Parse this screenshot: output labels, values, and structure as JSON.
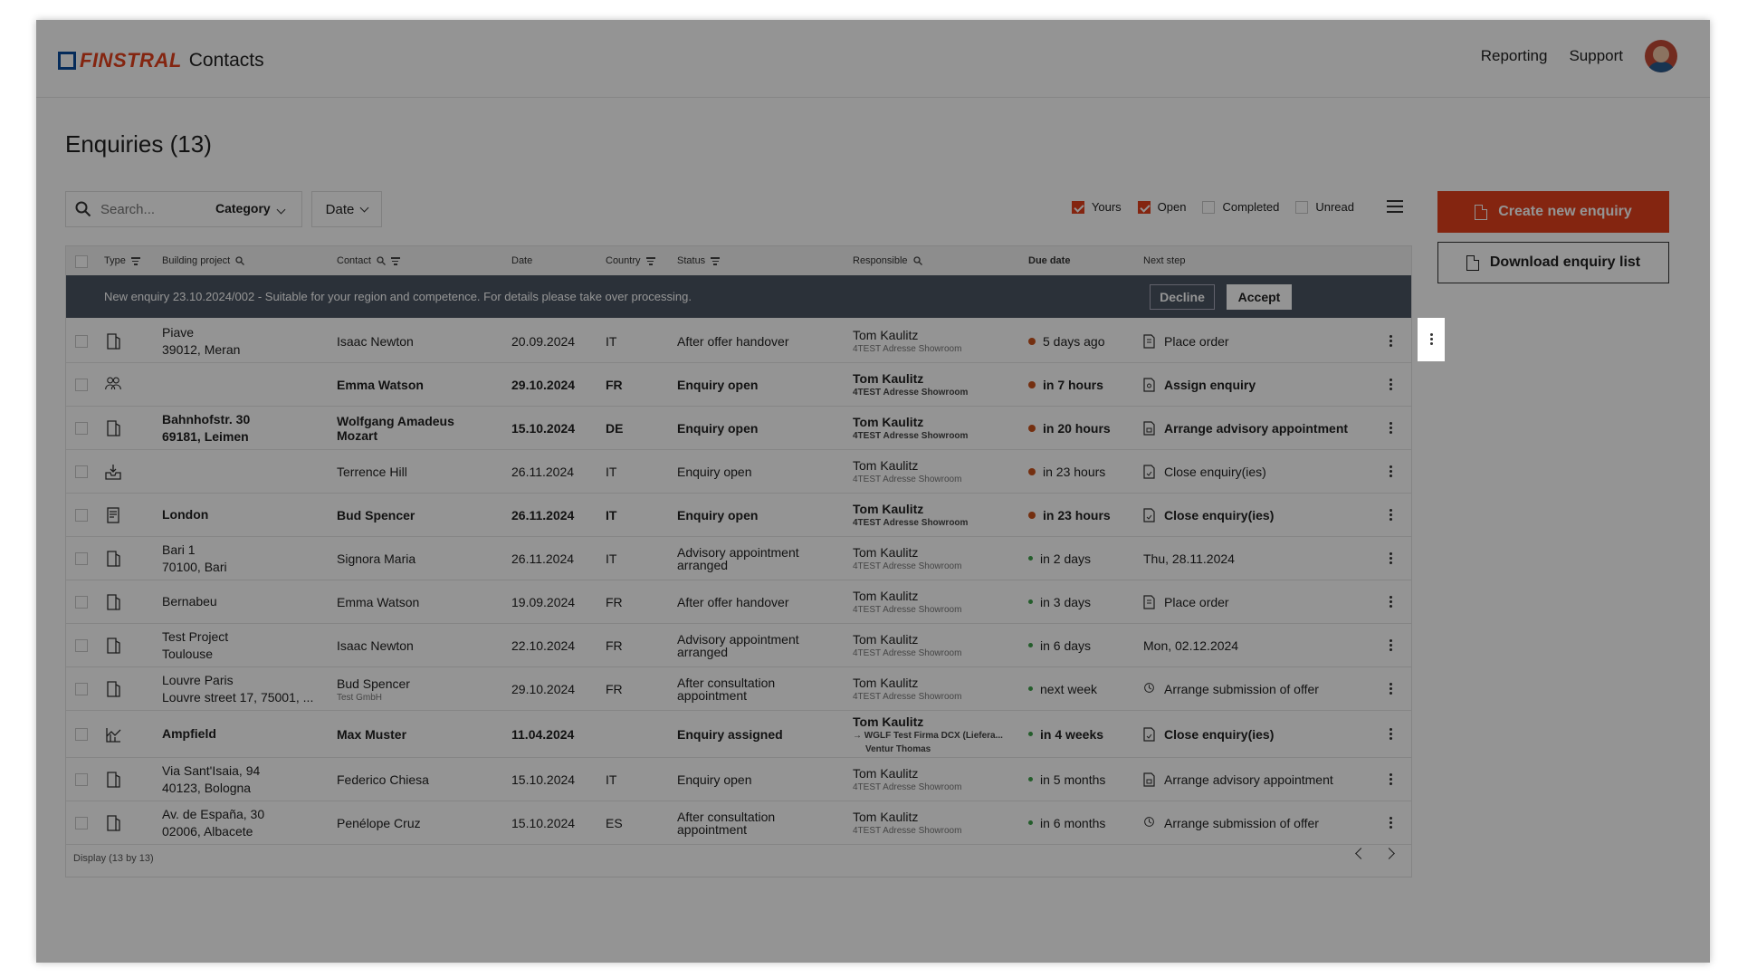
{
  "header": {
    "logo_brand": "FINSTRAL",
    "app_name": "Contacts",
    "nav": [
      "Reporting",
      "Support"
    ]
  },
  "page": {
    "title": "Enquiries (13)"
  },
  "filters": {
    "search_placeholder": "Search...",
    "category_label": "Category",
    "date_label": "Date",
    "toggles": [
      {
        "label": "Yours",
        "checked": true
      },
      {
        "label": "Open",
        "checked": true
      },
      {
        "label": "Completed",
        "checked": false
      },
      {
        "label": "Unread",
        "checked": false
      }
    ]
  },
  "actions": {
    "create_label": "Create new enquiry",
    "download_label": "Download enquiry list"
  },
  "table": {
    "columns": [
      "Type",
      "Building project",
      "Contact",
      "Date",
      "Country",
      "Status",
      "Responsible",
      "Due date",
      "Next step"
    ],
    "notice": {
      "message": "New enquiry 23.10.2024/002 - Suitable for your region and competence. For details please take over processing.",
      "decline": "Decline",
      "accept": "Accept"
    },
    "rows": [
      {
        "icon": "door-icon",
        "project": [
          "Piave",
          "39012, Meran"
        ],
        "contact": "Isaac Newton",
        "contact_sub": "",
        "date": "20.09.2024",
        "country": "IT",
        "status": [
          "After offer handover"
        ],
        "resp": "Tom Kaulitz",
        "resp_sub": "4TEST Adresse Showroom",
        "due": "5 days ago",
        "dot": "o",
        "next": "Place order",
        "next_icon": "order-icon",
        "bold": false
      },
      {
        "icon": "group-icon",
        "project": [],
        "contact": "Emma Watson",
        "contact_sub": "",
        "date": "29.10.2024",
        "country": "FR",
        "status": [
          "Enquiry open"
        ],
        "resp": "Tom Kaulitz",
        "resp_sub": "4TEST Adresse Showroom",
        "due": "in 7 hours",
        "dot": "o",
        "next": "Assign enquiry",
        "next_icon": "assign-icon",
        "bold": true
      },
      {
        "icon": "door-icon",
        "project": [
          "Bahnhofstr. 30",
          "69181, Leimen"
        ],
        "contact": "Wolfgang Amadeus Mozart",
        "contact_sub": "",
        "date": "15.10.2024",
        "country": "DE",
        "status": [
          "Enquiry open"
        ],
        "resp": "Tom Kaulitz",
        "resp_sub": "4TEST Adresse Showroom",
        "due": "in 20 hours",
        "dot": "o",
        "next": "Arrange advisory appointment",
        "next_icon": "appointment-icon",
        "bold": true
      },
      {
        "icon": "inbox-icon",
        "project": [],
        "contact": "Terrence Hill",
        "contact_sub": "",
        "date": "26.11.2024",
        "country": "IT",
        "status": [
          "Enquiry open"
        ],
        "resp": "Tom Kaulitz",
        "resp_sub": "4TEST Adresse Showroom",
        "due": "in 23 hours",
        "dot": "o",
        "next": "Close enquiry(ies)",
        "next_icon": "close-doc-icon",
        "bold": false
      },
      {
        "icon": "form-icon",
        "project": [
          "London"
        ],
        "contact": "Bud Spencer",
        "contact_sub": "",
        "date": "26.11.2024",
        "country": "IT",
        "status": [
          "Enquiry open"
        ],
        "resp": "Tom Kaulitz",
        "resp_sub": "4TEST Adresse Showroom",
        "due": "in 23 hours",
        "dot": "o",
        "next": "Close enquiry(ies)",
        "next_icon": "close-doc-icon",
        "bold": true
      },
      {
        "icon": "door-icon",
        "project": [
          "Bari 1",
          "70100, Bari"
        ],
        "contact": "Signora Maria",
        "contact_sub": "",
        "date": "26.11.2024",
        "country": "IT",
        "status": [
          "Advisory appointment",
          "arranged"
        ],
        "resp": "Tom Kaulitz",
        "resp_sub": "4TEST Adresse Showroom",
        "due": "in 2 days",
        "dot": "g",
        "next": "Thu, 28.11.2024",
        "next_icon": "",
        "bold": false
      },
      {
        "icon": "door-icon",
        "project": [
          "Bernabeu"
        ],
        "contact": "Emma Watson",
        "contact_sub": "",
        "date": "19.09.2024",
        "country": "FR",
        "status": [
          "After offer handover"
        ],
        "resp": "Tom Kaulitz",
        "resp_sub": "4TEST Adresse Showroom",
        "due": "in 3 days",
        "dot": "g",
        "next": "Place order",
        "next_icon": "order-icon",
        "bold": false
      },
      {
        "icon": "door-icon",
        "project": [
          "Test Project",
          "Toulouse"
        ],
        "contact": "Isaac Newton",
        "contact_sub": "",
        "date": "22.10.2024",
        "country": "FR",
        "status": [
          "Advisory appointment",
          "arranged"
        ],
        "resp": "Tom Kaulitz",
        "resp_sub": "4TEST Adresse Showroom",
        "due": "in 6 days",
        "dot": "g",
        "next": "Mon, 02.12.2024",
        "next_icon": "",
        "bold": false
      },
      {
        "icon": "door-icon",
        "project": [
          "Louvre Paris",
          "Louvre street 17, 75001, ..."
        ],
        "contact": "Bud Spencer",
        "contact_sub": "Test GmbH",
        "date": "29.10.2024",
        "country": "FR",
        "status": [
          "After consultation",
          "appointment"
        ],
        "resp": "Tom Kaulitz",
        "resp_sub": "4TEST Adresse Showroom",
        "due": "next week",
        "dot": "g",
        "next": "Arrange submission of offer",
        "next_icon": "submission-icon",
        "bold": false
      },
      {
        "icon": "plan-icon",
        "project": [
          "Ampfield"
        ],
        "contact": "Max Muster",
        "contact_sub": "",
        "date": "11.04.2024",
        "country": "",
        "status": [
          "Enquiry assigned"
        ],
        "resp": "Tom Kaulitz",
        "resp_sub": "→ WGLF Test Firma DCX (Liefera...",
        "resp_sub2": "Ventur Thomas",
        "due": "in 4 weeks",
        "dot": "g",
        "next": "Close enquiry(ies)",
        "next_icon": "close-doc-icon",
        "bold": true
      },
      {
        "icon": "door-icon",
        "project": [
          "Via Sant'Isaia, 94",
          "40123, Bologna"
        ],
        "contact": "Federico Chiesa",
        "contact_sub": "",
        "date": "15.10.2024",
        "country": "IT",
        "status": [
          "Enquiry open"
        ],
        "resp": "Tom Kaulitz",
        "resp_sub": "4TEST Adresse Showroom",
        "due": "in 5 months",
        "dot": "g",
        "next": "Arrange advisory appointment",
        "next_icon": "appointment-icon",
        "bold": false
      },
      {
        "icon": "door-icon",
        "project": [
          "Av. de España, 30",
          "02006, Albacete"
        ],
        "contact": "Penélope Cruz",
        "contact_sub": "",
        "date": "15.10.2024",
        "country": "ES",
        "status": [
          "After consultation",
          "appointment"
        ],
        "resp": "Tom Kaulitz",
        "resp_sub": "4TEST Adresse Showroom",
        "due": "in 6 months",
        "dot": "g",
        "next": "Arrange submission of offer",
        "next_icon": "submission-icon",
        "bold": false
      }
    ],
    "footer": "Display  (13 by 13)"
  }
}
